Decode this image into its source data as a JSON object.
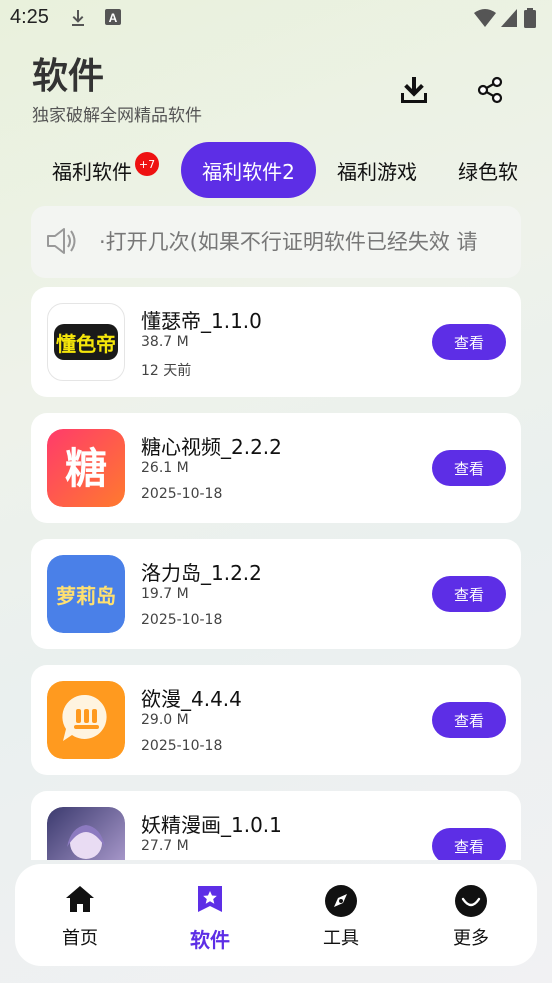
{
  "status": {
    "time": "4:25"
  },
  "header": {
    "title": "软件",
    "subtitle": "独家破解全网精品软件"
  },
  "tabs": [
    {
      "label": "福利软件",
      "badge": "+7"
    },
    {
      "label": "福利软件2"
    },
    {
      "label": "福利游戏"
    },
    {
      "label": "绿色软"
    }
  ],
  "notice": {
    "text": "·打开几次(如果不行证明软件已经失效 请"
  },
  "apps": [
    {
      "name": "懂瑟帝_1.1.0",
      "size": "38.7 M",
      "date": "12 天前",
      "button": "查看"
    },
    {
      "name": "糖心视频_2.2.2",
      "size": "26.1 M",
      "date": "2025-10-18",
      "button": "查看"
    },
    {
      "name": "洛力岛_1.2.2",
      "size": "19.7 M",
      "date": "2025-10-18",
      "button": "查看"
    },
    {
      "name": "欲漫_4.4.4",
      "size": "29.0 M",
      "date": "2025-10-18",
      "button": "查看"
    },
    {
      "name": "妖精漫画_1.0.1",
      "size": "27.7 M",
      "date": "",
      "button": "查看"
    }
  ],
  "app_icon_texts": {
    "app0": "懂色帝",
    "app1": "糖",
    "app2": "萝莉岛"
  },
  "nav": [
    {
      "label": "首页"
    },
    {
      "label": "软件"
    },
    {
      "label": "工具"
    },
    {
      "label": "更多"
    }
  ],
  "colors": {
    "accent": "#5d2ee6",
    "badge": "#e11111"
  }
}
